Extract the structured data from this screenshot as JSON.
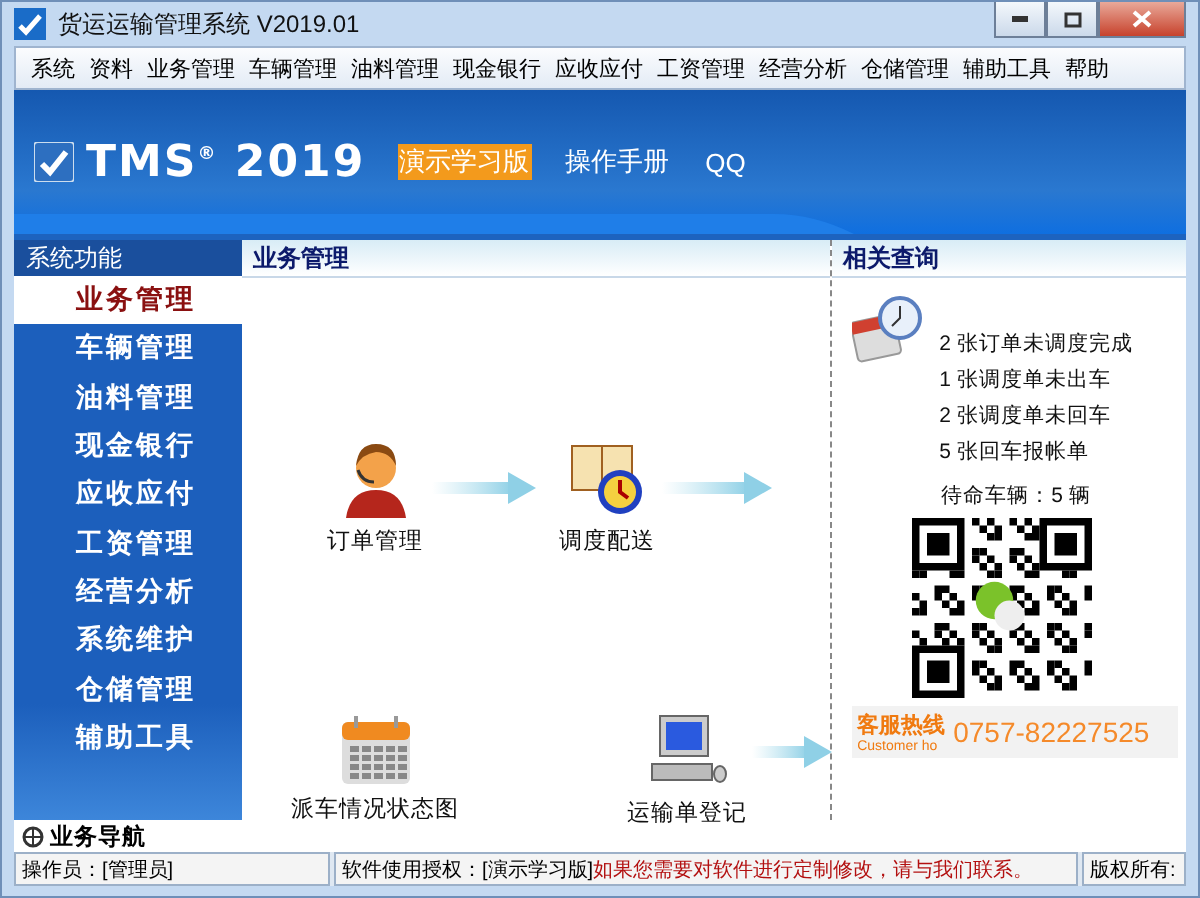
{
  "window": {
    "title": "货运运输管理系统 V2019.01"
  },
  "menu": [
    "系统",
    "资料",
    "业务管理",
    "车辆管理",
    "油料管理",
    "现金银行",
    "应收应付",
    "工资管理",
    "经营分析",
    "仓储管理",
    "辅助工具",
    "帮助"
  ],
  "banner": {
    "logo": "TMS",
    "logo_mark": "®",
    "logo_year": "2019",
    "links": [
      {
        "label": "演示学习版",
        "highlighted": true
      },
      {
        "label": "操作手册",
        "highlighted": false
      },
      {
        "label": "QQ",
        "highlighted": false
      }
    ]
  },
  "sidebar": {
    "title": "系统功能",
    "items": [
      {
        "label": "业务管理",
        "selected": true
      },
      {
        "label": "车辆管理",
        "selected": false
      },
      {
        "label": "油料管理",
        "selected": false
      },
      {
        "label": "现金银行",
        "selected": false
      },
      {
        "label": "应收应付",
        "selected": false
      },
      {
        "label": "工资管理",
        "selected": false
      },
      {
        "label": "经营分析",
        "selected": false
      },
      {
        "label": "系统维护",
        "selected": false
      },
      {
        "label": "仓储管理",
        "selected": false
      },
      {
        "label": "辅助工具",
        "selected": false
      }
    ]
  },
  "main": {
    "title": "业务管理",
    "nodes": [
      {
        "label": "订单管理",
        "kind": "operator"
      },
      {
        "label": "调度配送",
        "kind": "dispatch"
      },
      {
        "label": "派车情况状态图",
        "kind": "calendar"
      },
      {
        "label": "运输单登记",
        "kind": "computer"
      }
    ]
  },
  "related": {
    "title": "相关查询",
    "notices": [
      "2 张订单未调度完成",
      "1 张调度单未出车",
      "2 张调度单未回车",
      "5 张回车报帐单"
    ],
    "idle_vehicles": "待命车辆：5 辆",
    "hotline": {
      "label": "客服热线",
      "sublabel": "Customer ho",
      "phone": "0757-82227525"
    }
  },
  "bottom_tabs": [
    {
      "label": "业务导航",
      "selected": true
    }
  ],
  "status_bar": {
    "operator": "操作员：[管理员]",
    "license": "软件使用授权：[演示学习版]",
    "notice": "如果您需要对软件进行定制修改，请与我们联系。",
    "copyright": "版权所有:"
  }
}
